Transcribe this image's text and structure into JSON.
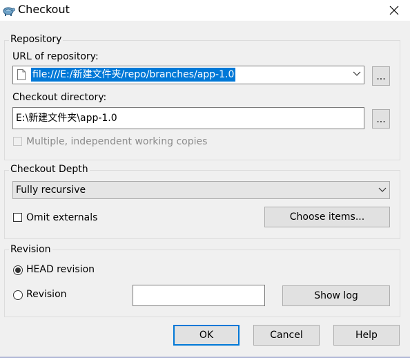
{
  "window": {
    "title": "Checkout"
  },
  "repository": {
    "group_label": "Repository",
    "url_label": "URL of repository:",
    "url_value": "file:///E:/新建文件夹/repo/branches/app-1.0",
    "browse_label": "...",
    "dir_label": "Checkout directory:",
    "dir_value": "E:\\新建文件夹\\app-1.0",
    "multiple_label": "Multiple, independent working copies"
  },
  "depth": {
    "group_label": "Checkout Depth",
    "selected": "Fully recursive",
    "omit_externals_label": "Omit externals",
    "choose_items_label": "Choose items..."
  },
  "revision": {
    "group_label": "Revision",
    "head_label": "HEAD revision",
    "revision_label": "Revision",
    "revision_value": "",
    "show_log_label": "Show log"
  },
  "buttons": {
    "ok": "OK",
    "cancel": "Cancel",
    "help": "Help"
  },
  "icons": {
    "app": "tortoise-icon",
    "close": "close-icon",
    "file": "file-icon",
    "dropdown": "chevron-down-icon"
  },
  "colors": {
    "selection": "#0078d7",
    "default_button_border": "#0078d7"
  }
}
